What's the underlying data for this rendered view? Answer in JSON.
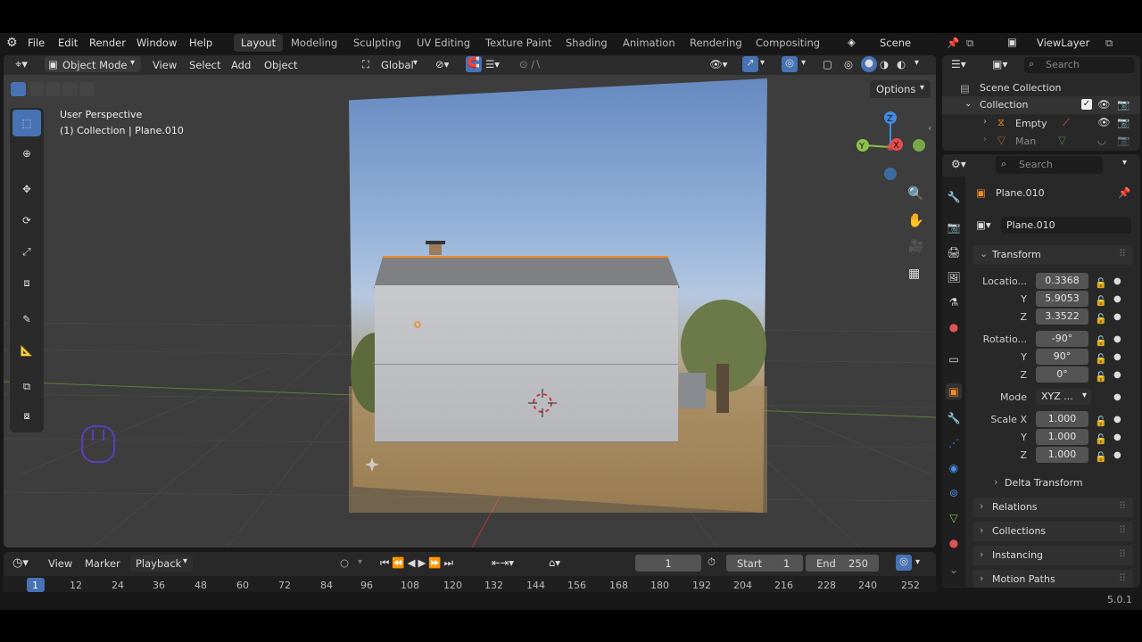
{
  "menu": {
    "file": "File",
    "edit": "Edit",
    "render": "Render",
    "window": "Window",
    "help": "Help"
  },
  "workspaces": [
    "Layout",
    "Modeling",
    "Sculpting",
    "UV Editing",
    "Texture Paint",
    "Shading",
    "Animation",
    "Rendering",
    "Compositing"
  ],
  "scene": {
    "name": "Scene",
    "view_layer": "ViewLayer"
  },
  "viewport": {
    "mode": "Object Mode",
    "view": "View",
    "select": "Select",
    "add": "Add",
    "object": "Object",
    "orientation": "Global",
    "options": "Options",
    "overlay_title": "User Perspective",
    "overlay_sub": "(1) Collection | Plane.010",
    "gizmo": {
      "x": "X",
      "y": "Y",
      "z": "Z"
    }
  },
  "outliner": {
    "search_placeholder": "Search",
    "root": "Scene Collection",
    "collection": "Collection",
    "items": [
      "Empty",
      "Man"
    ]
  },
  "properties": {
    "search_placeholder": "Search",
    "object_name": "Plane.010",
    "data_name": "Plane.010",
    "transform": "Transform",
    "location_label": "Locatio...",
    "location": [
      "0.3368",
      "5.9053",
      "3.3522"
    ],
    "rotation_label": "Rotatio...",
    "rotation": [
      "-90°",
      "90°",
      "0°"
    ],
    "mode_label": "Mode",
    "mode_value": "XYZ ...",
    "scale_label": "Scale X",
    "scale": [
      "1.000",
      "1.000",
      "1.000"
    ],
    "axis_y": "Y",
    "axis_z": "Z",
    "delta": "Delta Transform",
    "panels": [
      "Relations",
      "Collections",
      "Instancing",
      "Motion Paths"
    ]
  },
  "timeline": {
    "view": "View",
    "marker": "Marker",
    "playback": "Playback",
    "current_frame": "1",
    "start_label": "Start",
    "start": "1",
    "end_label": "End",
    "end": "250",
    "ruler": [
      "1",
      "12",
      "24",
      "36",
      "48",
      "60",
      "72",
      "84",
      "96",
      "108",
      "120",
      "132",
      "144",
      "156",
      "168",
      "180",
      "192",
      "204",
      "216",
      "228",
      "240",
      "252"
    ]
  },
  "version": "5.0.1",
  "colors": {
    "accent": "#4772b3",
    "selection": "#f08a24",
    "x_axis": "#e54b4b",
    "y_axis": "#8bc34a",
    "z_axis": "#3f8ce4"
  }
}
